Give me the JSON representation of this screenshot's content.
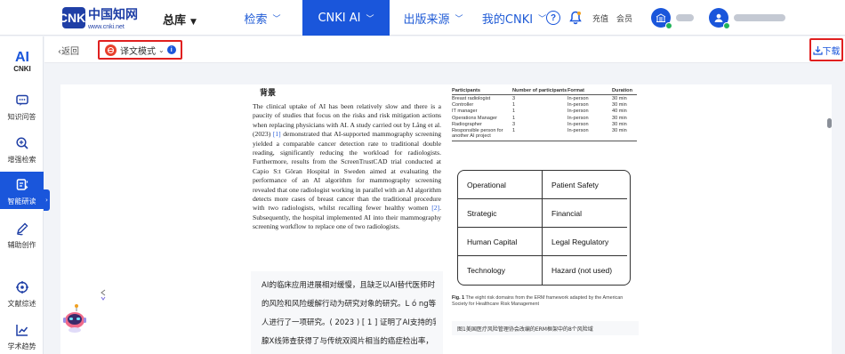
{
  "header": {
    "logo_mark": "CNKi",
    "logo_cn": "中国知网",
    "logo_url": "www.cnki.net",
    "library_label": "总库",
    "nav": [
      {
        "label": "检索",
        "caret": true,
        "active": false
      },
      {
        "label": "CNKI AI",
        "caret": true,
        "active": true
      },
      {
        "label": "出版来源",
        "caret": true,
        "active": false
      },
      {
        "label": "我的CNKI",
        "caret": true,
        "active": false
      }
    ],
    "help_label": "?",
    "recharge_label": "充值",
    "member_label": "会员"
  },
  "sidebar": {
    "logo_ai": "AI",
    "logo_cnki": "CNKI",
    "items": [
      {
        "label": "知识问答",
        "icon": "chat-icon",
        "active": false
      },
      {
        "label": "增强检索",
        "icon": "search-plus-icon",
        "active": false
      },
      {
        "label": "智能研读",
        "icon": "reading-icon",
        "active": true
      },
      {
        "label": "辅助创作",
        "icon": "pen-icon",
        "active": false
      },
      {
        "label": "文献综述",
        "icon": "target-icon",
        "active": false
      },
      {
        "label": "学术趋势",
        "icon": "trend-icon",
        "active": false
      }
    ]
  },
  "toolbar": {
    "back_label": "返回",
    "mode_label": "译文模式",
    "download_label": "下载"
  },
  "document": {
    "section_heading": "背景",
    "paragraph_parts": [
      {
        "text": "The clinical uptake of AI has been relatively slow and there is a paucity of studies that focus on the risks and risk mitigation actions when replacing physicians with AI. A study carried out by Lång et al. (2023) ",
        "ref": false
      },
      {
        "text": "[1]",
        "ref": true
      },
      {
        "text": " demonstrated that AI-supported mammography screening yielded a comparable cancer detection rate to traditional double reading, significantly reducing the workload for radiologists. Furthermore, results from the ScreenTrustCAD trial conducted at Capio S:t Göran Hospital in Sweden aimed at evaluating the performance of an AI algorithm for mammography screening revealed that one radiologist working in parallel with an AI algorithm detects more cases of breast cancer than the traditional procedure with two radiologists, whilst recalling fewer healthy women ",
        "ref": false
      },
      {
        "text": "[2]",
        "ref": true
      },
      {
        "text": ". Subsequently, the hospital implemented AI into their mammography screening workflow to replace one of two radiologists.",
        "ref": false
      }
    ],
    "translation_lines": [
      "AI的临床应用进展相对缓慢，且缺乏以AI替代医师时",
      "的风险和风险缓解行动为研究对象的研究。L ó ng等",
      "人进行了一项研究。( 2023 ) [ 1 ] 证明了AI支持的乳",
      "腺X线筛查获得了与传统双阅片相当的癌症检出率，"
    ]
  },
  "table": {
    "columns": [
      "Participants",
      "Number of participants",
      "Format",
      "Duration"
    ],
    "rows": [
      [
        "Breast radiologist",
        "3",
        "In-person",
        "30 min"
      ],
      [
        "Controller",
        "1",
        "In-person",
        "30 min"
      ],
      [
        "IT manager",
        "1",
        "In-person",
        "40 min"
      ],
      [
        "Operations Manager",
        "1",
        "In-person",
        "30 min"
      ],
      [
        "Radiographer",
        "3",
        "In-person",
        "30 min"
      ],
      [
        "Responsible person for another AI project",
        "1",
        "In-person",
        "30 min"
      ]
    ]
  },
  "figure": {
    "cells": [
      "Operational",
      "Patient Safety",
      "Strategic",
      "Financial",
      "Human Capital",
      "Legal Regulatory",
      "Technology",
      "Hazard (not used)"
    ],
    "caption_label": "Fig. 1",
    "caption_text": "The eight risk domains from the ERM framework adapted by the American Society for Healthcare Risk Management",
    "caption_translation": "图1美国医疗风险管理协会改编的ERM框架中的8个风险域"
  },
  "colors": {
    "accent": "#1a56db",
    "highlight_border": "#e02020"
  }
}
